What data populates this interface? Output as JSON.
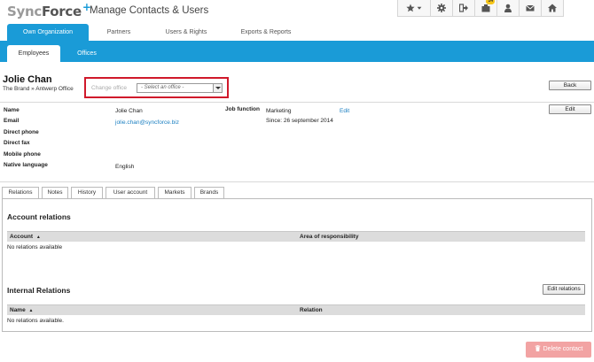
{
  "header": {
    "logo_sync": "Sync",
    "logo_force": "Force",
    "logo_plus": "+",
    "app_title": "Manage Contacts & Users",
    "toolbar": [
      {
        "icon": "star-icon"
      },
      {
        "icon": "gear-icon"
      },
      {
        "icon": "sign-out-icon"
      },
      {
        "icon": "inbox-icon",
        "badge": "14"
      },
      {
        "icon": "user-icon"
      },
      {
        "icon": "mail-icon"
      },
      {
        "icon": "home-icon"
      }
    ]
  },
  "main_tabs": [
    "Own Organization",
    "Partners",
    "Users & Rights",
    "Exports & Reports"
  ],
  "sub_tabs": [
    "Employees",
    "Offices"
  ],
  "person": {
    "name": "Jolie Chan",
    "breadcrumb": "The Brand » Antwerp Office",
    "change_office_label": "Change office",
    "office_select_value": "- Select an office -",
    "back_label": "Back",
    "edit_label": "Edit"
  },
  "details": {
    "name_label": "Name",
    "name_value": "Jolie Chan",
    "email_label": "Email",
    "email_value": "jolie.chan@syncforce.biz",
    "direct_phone_label": "Direct phone",
    "direct_fax_label": "Direct fax",
    "mobile_phone_label": "Mobile phone",
    "native_language_label": "Native language",
    "native_language_value": "English",
    "job_function_label": "Job function",
    "job_function_value": "Marketing",
    "job_function_edit": "Edit",
    "job_since": "Since: 26 september 2014"
  },
  "lower_tabs": [
    "Relations",
    "Notes",
    "History",
    "User account",
    "Markets",
    "Brands"
  ],
  "account_relations": {
    "title": "Account relations",
    "col_account": "Account",
    "col_area": "Area of responsibility",
    "empty": "No relations available"
  },
  "internal_relations": {
    "title": "Internal Relations",
    "edit_button": "Edit relations",
    "col_name": "Name",
    "col_relation": "Relation",
    "empty": "No relations available."
  },
  "delete_contact": "Delete contact",
  "colors": {
    "accent": "#1a9bd7",
    "highlight_border": "#d0192b",
    "delete_button": "#f2a3a3"
  }
}
